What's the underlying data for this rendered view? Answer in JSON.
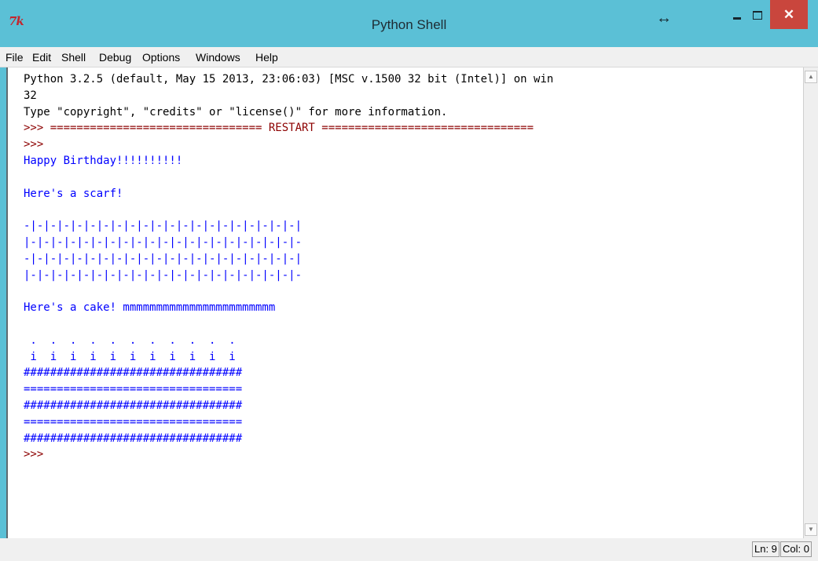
{
  "window": {
    "app_icon_text": "7k",
    "title": "Python Shell",
    "controls": {
      "resize_symbol": "↔",
      "close_symbol": "✕"
    }
  },
  "menu": [
    "File",
    "Edit",
    "Shell",
    "Debug",
    "Options",
    "Windows",
    "Help"
  ],
  "shell_lines": [
    {
      "text": "Python 3.2.5 (default, May 15 2013, 23:06:03) [MSC v.1500 32 bit (Intel)] on win",
      "style": "black"
    },
    {
      "text": "32",
      "style": "black"
    },
    {
      "text": "Type \"copyright\", \"credits\" or \"license()\" for more information.",
      "style": "black"
    },
    {
      "text": ">>> ================================ RESTART ================================",
      "style": "prompt"
    },
    {
      "text": ">>>",
      "style": "prompt"
    },
    {
      "text": "Happy Birthday!!!!!!!!!!",
      "style": "blue"
    },
    {
      "text": "",
      "style": "blue"
    },
    {
      "text": "Here's a scarf!",
      "style": "blue"
    },
    {
      "text": "",
      "style": "blue"
    },
    {
      "text": "-|-|-|-|-|-|-|-|-|-|-|-|-|-|-|-|-|-|-|-|-|",
      "style": "blue"
    },
    {
      "text": "|-|-|-|-|-|-|-|-|-|-|-|-|-|-|-|-|-|-|-|-|-",
      "style": "blue"
    },
    {
      "text": "-|-|-|-|-|-|-|-|-|-|-|-|-|-|-|-|-|-|-|-|-|",
      "style": "blue"
    },
    {
      "text": "|-|-|-|-|-|-|-|-|-|-|-|-|-|-|-|-|-|-|-|-|-",
      "style": "blue"
    },
    {
      "text": "",
      "style": "blue"
    },
    {
      "text": "Here's a cake! mmmmmmmmmmmmmmmmmmmmmmm",
      "style": "blue"
    },
    {
      "text": "",
      "style": "blue"
    },
    {
      "text": " .  .  .  .  .  .  .  .  .  .  .",
      "style": "blue"
    },
    {
      "text": " i  i  i  i  i  i  i  i  i  i  i",
      "style": "blue"
    },
    {
      "text": "#################################",
      "style": "blue"
    },
    {
      "text": "=================================",
      "style": "blue"
    },
    {
      "text": "#################################",
      "style": "blue"
    },
    {
      "text": "=================================",
      "style": "blue"
    },
    {
      "text": "#################################",
      "style": "blue"
    },
    {
      "text": ">>>",
      "style": "prompt"
    }
  ],
  "status": {
    "line": "Ln: 9",
    "col": "Col: 0"
  },
  "colors": {
    "title_bar": "#5bc0d6",
    "close_button": "#c9463d",
    "output_text": "#0000ff",
    "prompt_text": "#8c0000"
  }
}
